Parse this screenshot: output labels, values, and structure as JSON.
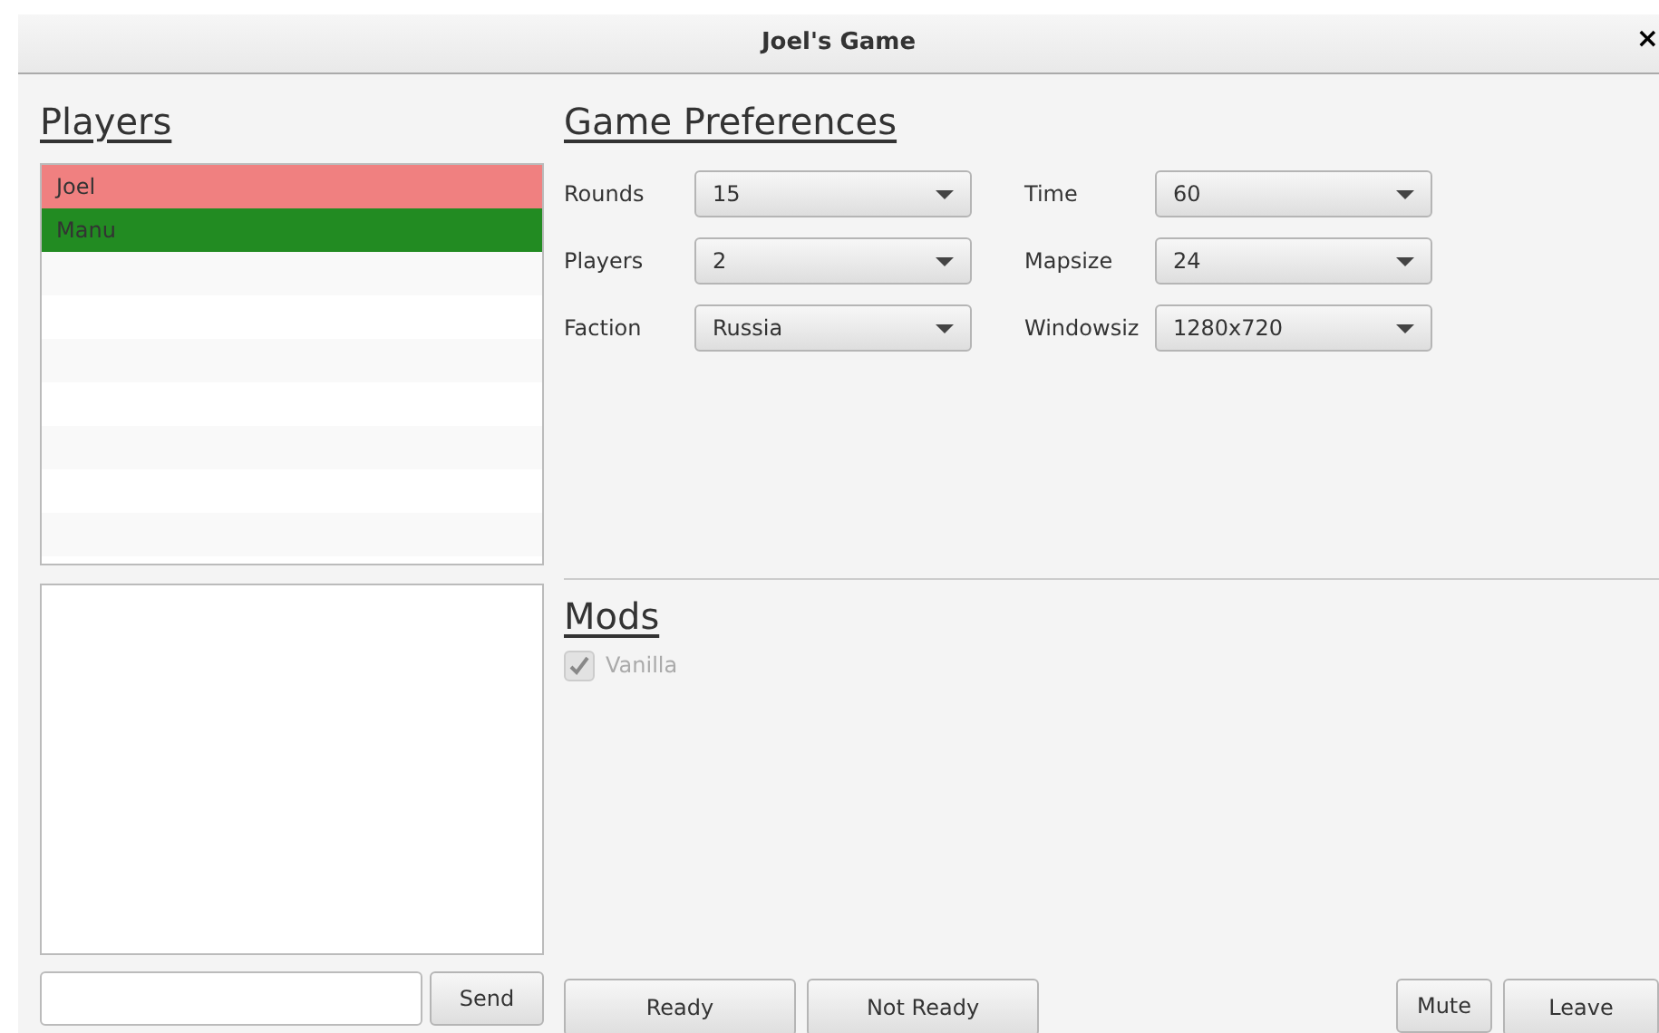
{
  "window": {
    "title": "Joel's Game",
    "close": "×"
  },
  "players": {
    "heading": "Players",
    "items": [
      {
        "name": "Joel",
        "color": "#f08080"
      },
      {
        "name": "Manu",
        "color": "#228b22"
      }
    ]
  },
  "chat": {
    "send": "Send"
  },
  "preferences": {
    "heading": "Game Preferences",
    "fields": [
      {
        "label": "Rounds",
        "value": "15"
      },
      {
        "label": "Time",
        "value": "60"
      },
      {
        "label": "Players",
        "value": "2"
      },
      {
        "label": "Mapsize",
        "value": "24"
      },
      {
        "label": "Faction",
        "value": "Russia"
      },
      {
        "label": "Windowsiz",
        "value": "1280x720"
      }
    ]
  },
  "mods": {
    "heading": "Mods",
    "items": [
      {
        "label": "Vanilla",
        "checked": true,
        "disabled": true
      }
    ]
  },
  "buttons": {
    "ready": "Ready",
    "not_ready": "Not Ready",
    "mute": "Mute",
    "leave": "Leave"
  }
}
